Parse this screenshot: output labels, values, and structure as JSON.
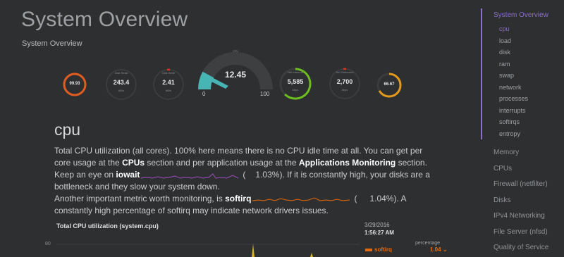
{
  "header": {
    "title": "System Overview",
    "subtitle": "System Overview"
  },
  "gauges": {
    "swap": {
      "value": "99.93",
      "percent": 99.93,
      "color": "#e05d1f"
    },
    "disk_read": {
      "title": "Disk Read",
      "value": "243.4",
      "unit": "kB/s"
    },
    "disk_write": {
      "title": "Disk Write",
      "value": "2.41",
      "unit": "kB/s"
    },
    "cpu": {
      "title": "CPU",
      "value": "12.45",
      "min": "0",
      "max": "100",
      "percent": 12.45,
      "color": "#47b5b3"
    },
    "net_inbound": {
      "title": "Net Inbound",
      "value": "5,585",
      "unit": "kbps",
      "color": "#6cbe1e"
    },
    "net_outbound": {
      "title": "Net Outbound",
      "value": "2,700",
      "unit": "kbps"
    },
    "ram": {
      "value": "66.67",
      "percent": 66.67,
      "color": "#e39a1a"
    }
  },
  "section": {
    "heading": "cpu",
    "lines": {
      "l1": "Total CPU utilization (all cores). 100% here means there is no CPU idle time at all. You can get per",
      "l2_pre": "core usage at the ",
      "l2_cpus": "CPUs",
      "l2_mid": " section and per application usage at the ",
      "l2_apps": "Applications Monitoring",
      "l2_post": " section.",
      "l3_pre": "Keep an eye on ",
      "l3_key": "iowait",
      "l3_open": "(",
      "l3_val": "1.03%",
      "l3_post": "). If it is constantly high, your disks are a",
      "l4": "bottleneck and they slow your system down.",
      "l5_pre": "Another important metric worth monitoring, is ",
      "l5_key": "softirq",
      "l5_open": "(",
      "l5_val": "1.04%",
      "l5_post": "). A",
      "l6": "constantly high percentage of softirq may indicate network drivers issues."
    }
  },
  "chart": {
    "title": "Total CPU utilization (system.cpu)",
    "ytick": "80",
    "legend": {
      "date": "3/29/2016",
      "time": "1:56:27 AM",
      "unit": "percentage",
      "name": "softirq",
      "value": "1.04"
    }
  },
  "colors": {
    "accent": "#8b6fc9",
    "iowait": "#a04cc1",
    "softirq": "#e66a0b"
  },
  "nav": {
    "top": "System Overview",
    "sub": [
      "cpu",
      "load",
      "disk",
      "ram",
      "swap",
      "network",
      "processes",
      "interrupts",
      "softirqs",
      "entropy"
    ],
    "main": [
      "Memory",
      "CPUs",
      "Firewall (netfilter)",
      "Disks",
      "IPv4 Networking",
      "File Server (nfsd)",
      "Quality of Service"
    ]
  }
}
